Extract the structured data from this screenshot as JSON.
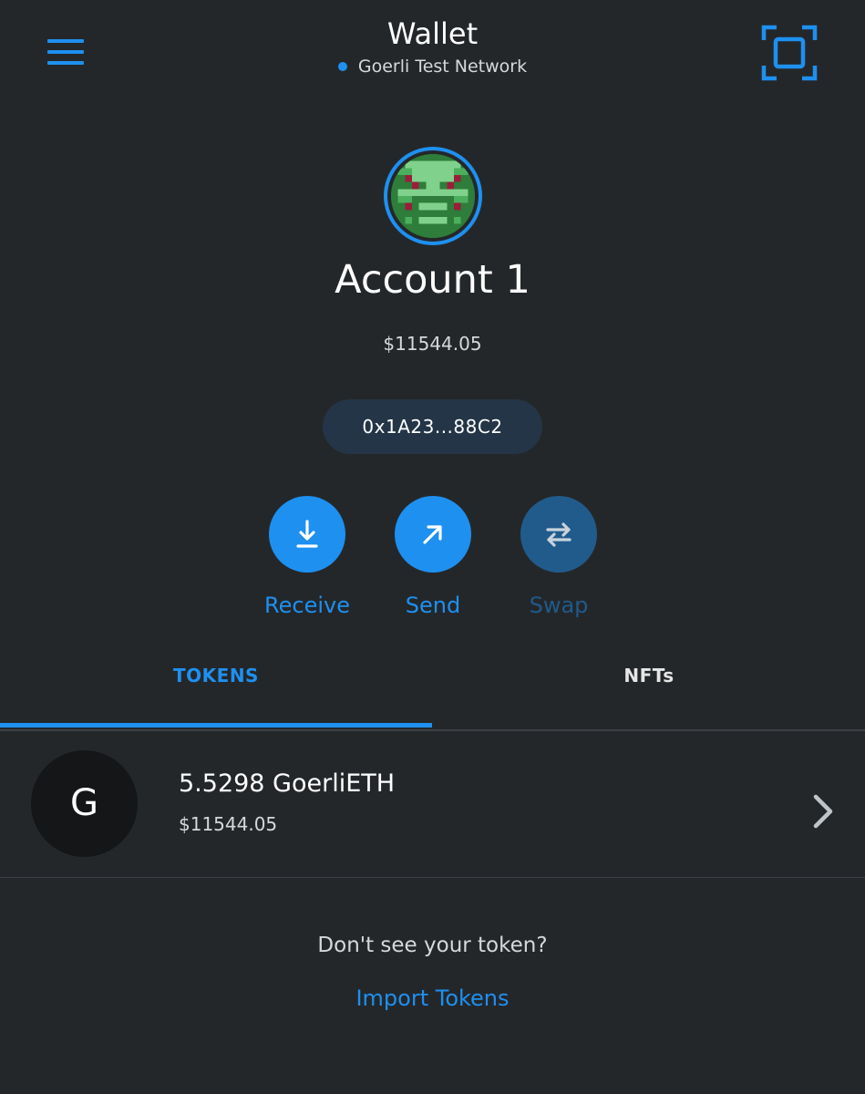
{
  "header": {
    "title": "Wallet",
    "network": "Goerli Test Network",
    "menu_icon": "hamburger-menu-icon",
    "scan_icon": "qr-scan-icon"
  },
  "account": {
    "name": "Account 1",
    "fiat_balance": "$11544.05",
    "address": "0x1A23...88C2"
  },
  "actions": [
    {
      "label": "Receive",
      "icon": "receive-arrow-down-icon",
      "enabled": true
    },
    {
      "label": "Send",
      "icon": "send-arrow-up-right-icon",
      "enabled": true
    },
    {
      "label": "Swap",
      "icon": "swap-arrows-icon",
      "enabled": false
    }
  ],
  "tabs": [
    {
      "label": "TOKENS",
      "active": true
    },
    {
      "label": "NFTs",
      "active": false
    }
  ],
  "tokens": [
    {
      "avatar_letter": "G",
      "amount": "5.5298 GoerliETH",
      "fiat": "$11544.05"
    }
  ],
  "footer": {
    "prompt": "Don't see your token?",
    "import_link": "Import Tokens"
  },
  "colors": {
    "background": "#24272a",
    "accent": "#1e90f0",
    "accent_disabled": "#215b8c",
    "address_pill": "#233546"
  }
}
